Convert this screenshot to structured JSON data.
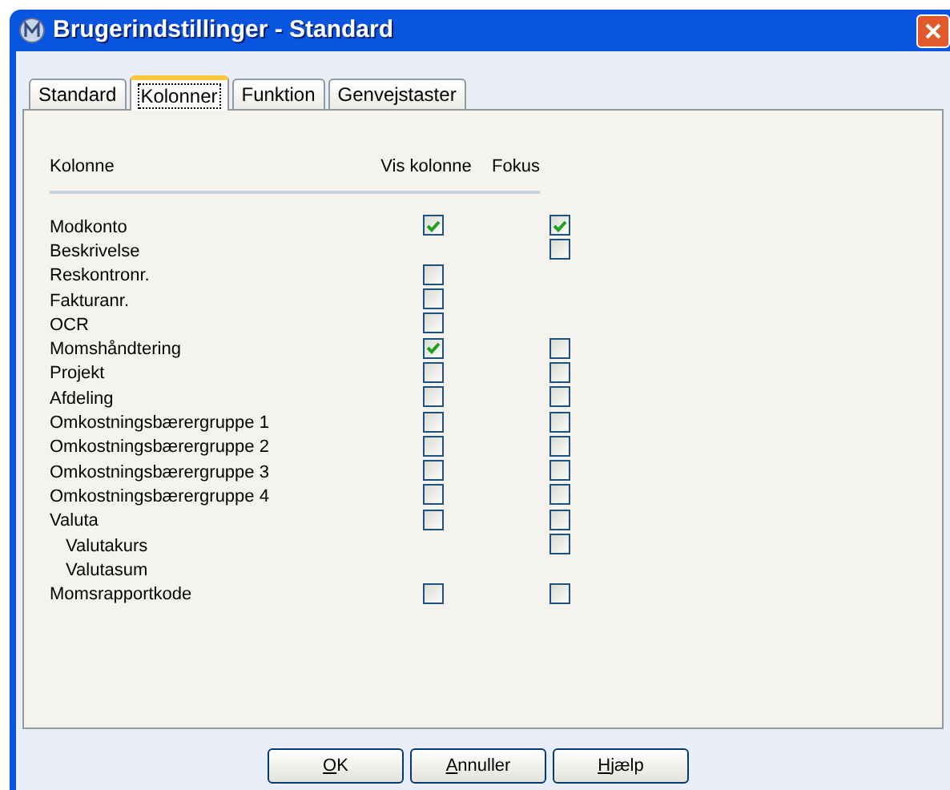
{
  "window": {
    "title": "Brugerindstillinger - Standard"
  },
  "tabs": [
    {
      "label": "Standard",
      "selected": false
    },
    {
      "label": "Kolonner",
      "selected": true
    },
    {
      "label": "Funktion",
      "selected": false
    },
    {
      "label": "Genvejstaster",
      "selected": false
    }
  ],
  "table": {
    "columns": [
      "Kolonne",
      "Vis kolonne",
      "Fokus"
    ],
    "rows": [
      {
        "label": "Modkonto",
        "vis": {
          "checked": true
        },
        "fokus": {
          "checked": true
        }
      },
      {
        "label": "Beskrivelse",
        "fokus": {
          "checked": false
        }
      },
      {
        "label": "Reskontronr.",
        "vis": {
          "checked": false
        }
      },
      {
        "label": "Fakturanr.",
        "vis": {
          "checked": false
        }
      },
      {
        "label": "OCR",
        "vis": {
          "checked": false
        }
      },
      {
        "label": "Momshåndtering",
        "vis": {
          "checked": true
        },
        "fokus": {
          "checked": false
        }
      },
      {
        "label": "Projekt",
        "vis": {
          "checked": false
        },
        "fokus": {
          "checked": false
        }
      },
      {
        "label": "Afdeling",
        "vis": {
          "checked": false
        },
        "fokus": {
          "checked": false
        }
      },
      {
        "label": "Omkostningsbærergruppe 1",
        "vis": {
          "checked": false
        },
        "fokus": {
          "checked": false
        }
      },
      {
        "label": "Omkostningsbærergruppe 2",
        "vis": {
          "checked": false
        },
        "fokus": {
          "checked": false
        }
      },
      {
        "label": "Omkostningsbærergruppe 3",
        "vis": {
          "checked": false
        },
        "fokus": {
          "checked": false
        }
      },
      {
        "label": "Omkostningsbærergruppe 4",
        "vis": {
          "checked": false
        },
        "fokus": {
          "checked": false
        }
      },
      {
        "label": "Valuta",
        "vis": {
          "checked": false
        },
        "fokus": {
          "checked": false
        },
        "children": [
          {
            "label": "Valutakurs",
            "fokus": {
              "checked": false
            }
          },
          {
            "label": "Valutasum"
          }
        ]
      },
      {
        "label": "Momsrapportkode",
        "vis": {
          "checked": false
        },
        "fokus": {
          "checked": false
        }
      }
    ]
  },
  "buttons": [
    {
      "access_key": "O",
      "label_rest": "K"
    },
    {
      "access_key": "A",
      "label_rest": "nnuller"
    },
    {
      "access_key": "H",
      "label_rest": "jælp"
    }
  ]
}
